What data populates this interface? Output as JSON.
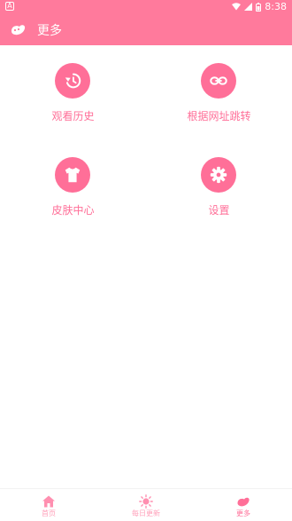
{
  "status_bar": {
    "left_icon": "A",
    "time": "8:38",
    "icons": [
      "wifi-icon",
      "signal-icon",
      "battery-icon"
    ]
  },
  "app_bar": {
    "logo_icon": "bean-logo-icon",
    "title": "更多"
  },
  "grid": [
    {
      "label": "观看历史",
      "icon": "history-icon"
    },
    {
      "label": "根据网址跳转",
      "icon": "link-icon"
    },
    {
      "label": "皮肤中心",
      "icon": "tshirt-icon"
    },
    {
      "label": "设置",
      "icon": "gear-icon"
    }
  ],
  "bottom_nav": [
    {
      "label": "首页",
      "icon": "home-icon",
      "active": false
    },
    {
      "label": "每日更新",
      "icon": "sun-icon",
      "active": false
    },
    {
      "label": "更多",
      "icon": "bean-icon",
      "active": true
    }
  ],
  "colors": {
    "primary": "#ff7a9c",
    "accent": "#ff6f98",
    "inactive": "#ff9fb9"
  }
}
